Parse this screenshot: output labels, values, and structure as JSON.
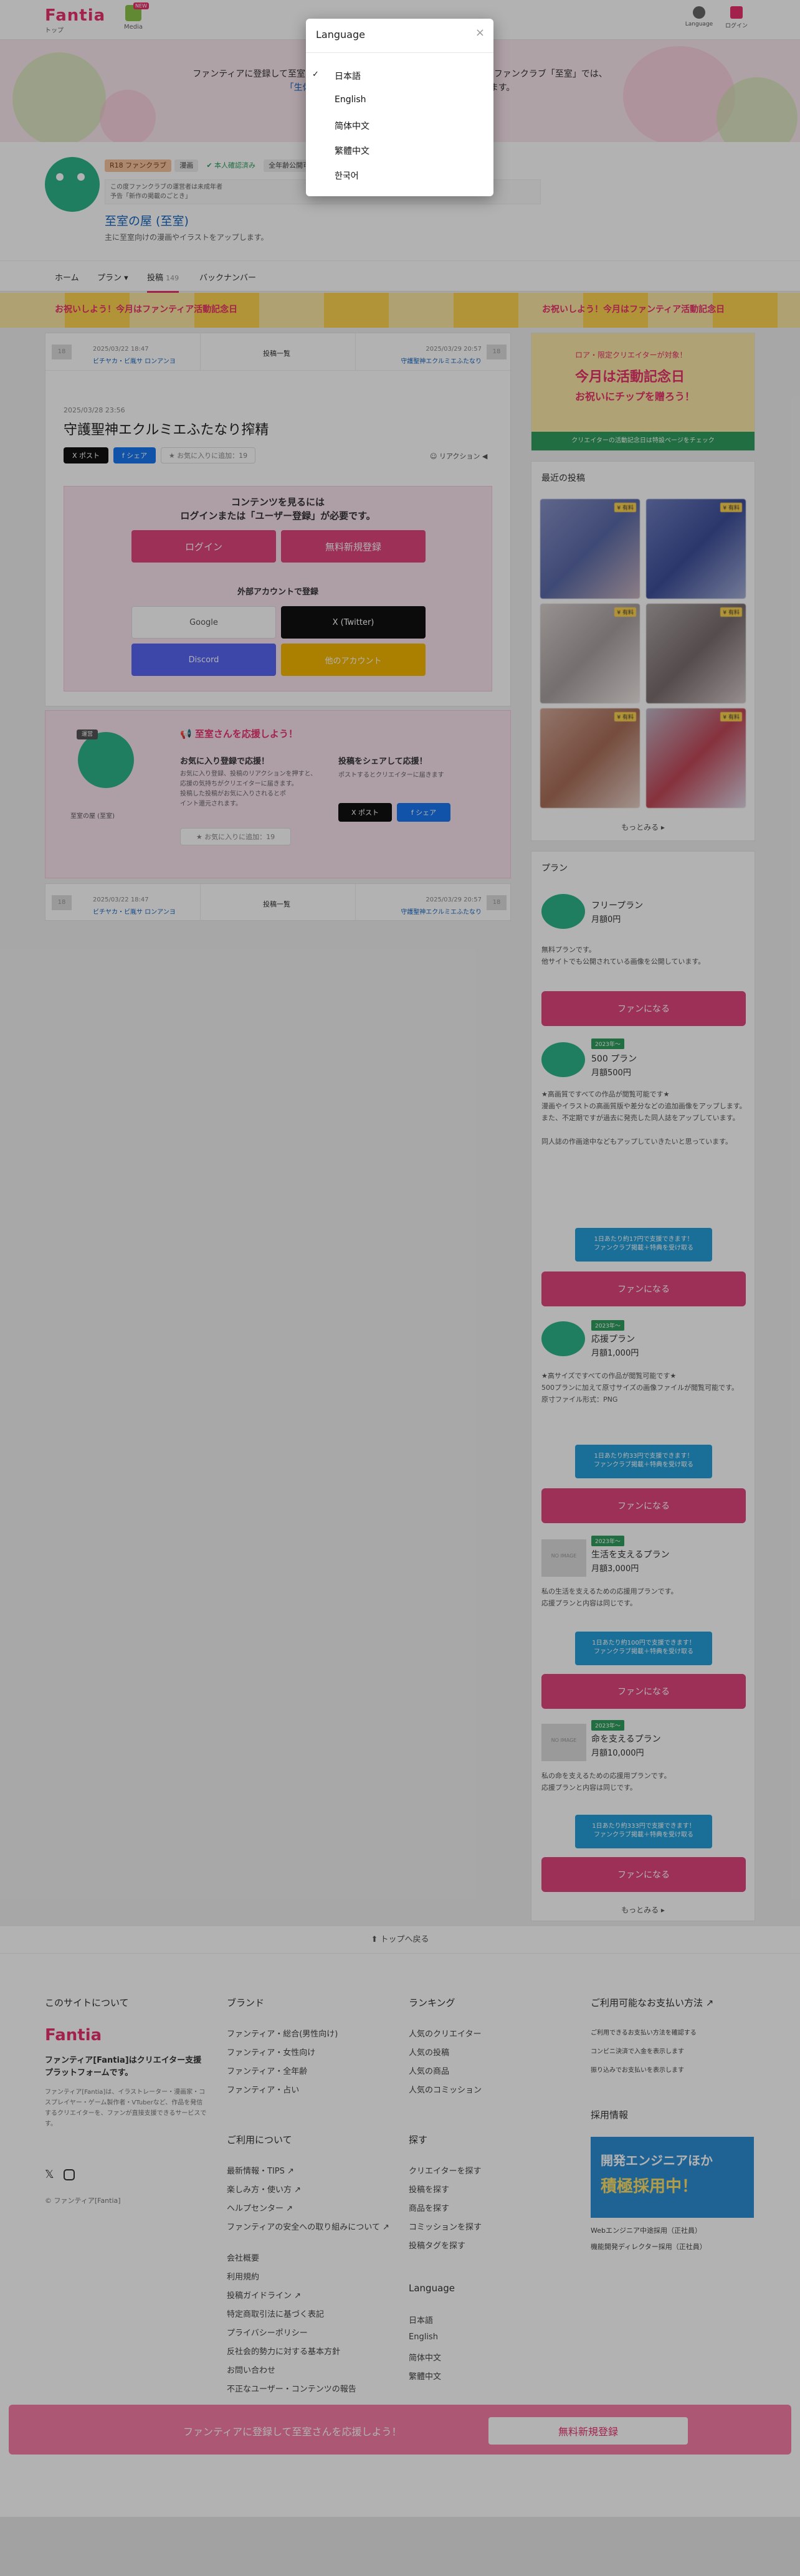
{
  "header": {
    "logo": "Fantia",
    "logo_sub": "トップ",
    "media_label": "Media",
    "new_badge": "NEW",
    "language_label": "Language",
    "login_label": "ログイン"
  },
  "banner": {
    "line1": "ファンティアに登録して至室さんを応援しよう！",
    "line1_right": "至室さんのファンクラブ「至室」では、",
    "line2": "「生体照料生成量",
    "line2_right": "いただけます。"
  },
  "profile": {
    "tag_adult": "R18 ファンクラブ",
    "tag_manga": "漫画",
    "tag_verified": "✔ 本人確認済み",
    "tag_extra": "全年齢公開可能・成人向け作品あり",
    "creator_name": "至室の屋 (至室)",
    "creator_desc": "主に至室向けの漫画やイラストをアップします。",
    "intro_l1": "この度ファンクラブの運営者は未成年者",
    "intro_l2": "予告「新作の掲載のごとき」"
  },
  "nav": {
    "home": "ホーム",
    "plans": "プラン",
    "posts": "投稿",
    "posts_count": "149",
    "backnumber": "バックナンバー"
  },
  "strip_text": "お祝いしよう！今月はファンティア活動記念日",
  "post": {
    "prev_date": "2025/03/22 18:47",
    "prev_title": "ビチヤカ・ビ胤サ ロンアンヨ",
    "list_label": "投稿一覧",
    "next_date": "2025/03/29 20:57",
    "next_title": "守護聖神エクルミエふたなり",
    "date": "2025/03/28 23:56",
    "title": "守護聖神エクルミエふたなり搾精",
    "share_x": "X ポスト",
    "share_fb": "f シェア",
    "fav_btn": "★ お気に入りに追加：19",
    "reaction": "☺ リアクション ◀"
  },
  "locked": {
    "heading1": "コンテンツを見るには",
    "heading2": "ログインまたは「ユーザー登録」が必要です。",
    "login": "ログイン",
    "register": "無料新規登録",
    "external_heading": "外部アカウントで登録",
    "google": "Google",
    "twitter": "X (Twitter)",
    "discord": "Discord",
    "other": "他のアカウント"
  },
  "support": {
    "badge": "運営",
    "title": "📢 至室さんを応援しよう！",
    "fav_title": "お気に入り登録で応援！",
    "fav_desc1": "お気に入り登録、投稿のリアクションを押すと、",
    "fav_desc2": "応援の気持ちがクリエイターに届きます。",
    "fav_desc3": "投稿した投稿がお気に入りされるとポ",
    "fav_desc4": "イント還元されます。",
    "share_title": "投稿をシェアして応援！",
    "share_desc": "ポストするとクリエイターに届きます",
    "fav_btn": "★ お気に入りに追加：19",
    "share_x": "X ポスト",
    "share_fb": "f シェア",
    "avatar_name": "至室の屋 (至室)"
  },
  "sidebar": {
    "promo_line1": "ロア・限定クリエイターが対象！",
    "promo_line2": "今月は活動記念日",
    "promo_line3": "お祝いにチップを贈ろう！",
    "promo_footer": "クリエイターの活動記念日は特設ページをチェック",
    "recent_title": "最近の投稿",
    "thumb_badge": "¥ 有料",
    "more": "もっとみる ▸",
    "plans_title": "プラン",
    "plans": [
      {
        "tag": "",
        "name": "フリープラン",
        "price": "月額0円",
        "desc": "無料プランです。\n他サイトでも公開されている画像を公開しています。",
        "tip": "",
        "button": "ファンになる"
      },
      {
        "tag": "2023年〜",
        "name": "500 プラン",
        "price": "月額500円",
        "desc": "★高画質ですべての作品が閲覧可能です★\n漫画やイラストの高画質版や差分などの追加画像をアップします。\nまた、不定期ですが過去に発売した同人誌をアップしています。\n\n同人誌の作画途中などもアップしていきたいと思っています。",
        "tip": "1日あたり約17円で支援できます！\nファンクラブ掲載＋特典を受け取る",
        "button": "ファンになる"
      },
      {
        "tag": "2023年〜",
        "name": "応援プラン",
        "price": "月額1,000円",
        "desc": "★高サイズですべての作品が閲覧可能です★\n500プランに加えて原寸サイズの画像ファイルが閲覧可能です。\n原寸ファイル形式：PNG",
        "tip": "1日あたり約33円で支援できます！\nファンクラブ掲載＋特典を受け取る",
        "button": "ファンになる"
      },
      {
        "tag": "2023年〜",
        "name": "生活を支えるプラン",
        "price": "月額3,000円",
        "desc": "私の生活を支えるための応援用プランです。\n応援プランと内容は同じです。",
        "tip": "1日あたり約100円で支援できます！\nファンクラブ掲載＋特典を受け取る",
        "button": "ファンになる"
      },
      {
        "tag": "2023年〜",
        "name": "命を支えるプラン",
        "price": "月額10,000円",
        "desc": "私の命を支えるための応援用プランです。\n応援プランと内容は同じです。",
        "tip": "1日あたり約333円で支援できます！\nファンクラブ掲載＋特典を受け取る",
        "button": "ファンになる"
      }
    ],
    "no_image": "NO IMAGE"
  },
  "back_to_top": "⬆ トップへ戻る",
  "footer": {
    "about_head": "このサイトについて",
    "about_logo": "Fantia",
    "about_title": "ファンティア[Fantia]はクリエイター支援プラットフォームです。",
    "about_desc": "ファンティア[Fantia]は、イラストレーター・漫画家・コスプレイヤー・ゲーム製作者・VTuberなど、作品を発信するクリエイターを、ファンが直接支援できるサービスです。",
    "copyright": "© ファンティア[Fantia]",
    "brand_head": "ブランド",
    "brand_links": [
      "ファンティア・総合(男性向け)",
      "ファンティア・女性向け",
      "ファンティア・全年齢",
      "ファンティア・占い"
    ],
    "ranking_head": "ランキング",
    "ranking_links": [
      "人気のクリエイター",
      "人気の投稿",
      "人気の商品",
      "人気のコミッション"
    ],
    "help_head": "ご利用可能なお支払い方法 ↗",
    "help_links": [
      "ご利用できるお支払い方法を確認する",
      "コンビニ決済で入金を表示します",
      "振り込みでお支払いを表示します"
    ],
    "use_head": "ご利用について",
    "use_links": [
      "最新情報・TIPS ↗",
      "楽しみ方・使い方 ↗",
      "ヘルプセンター ↗",
      "ファンティアの安全への取り組みについて ↗",
      "会社概要",
      "利用規約",
      "投稿ガイドライン ↗",
      "特定商取引法に基づく表記",
      "プライバシーポリシー",
      "反社会的勢力に対する基本方針",
      "お問い合わせ",
      "不正なユーザー・コンテンツの報告"
    ],
    "find_head": "探す",
    "find_links": [
      "クリエイターを探す",
      "投稿を探す",
      "商品を探す",
      "コミッションを探す",
      "投稿タグを探す"
    ],
    "jobs_head": "採用情報",
    "jobs_banner1": "開発エンジニアほか",
    "jobs_banner2": "積極採用中！",
    "jobs_links": [
      "Webエンジニア中途採用（正社員）",
      "機能開発ディレクター採用（正社員）"
    ],
    "lang_head": "Language",
    "lang_links": [
      "日本語",
      "English",
      "简体中文",
      "繁體中文"
    ]
  },
  "bottom_bar": {
    "text": "ファンティアに登録して至室さんを応援しよう！",
    "button": "無料新規登録"
  },
  "modal": {
    "title": "Language",
    "close": "×",
    "options": [
      "日本語",
      "English",
      "简体中文",
      "繁體中文",
      "한국어"
    ],
    "selected_index": 0,
    "checkmark": "✓"
  },
  "colors": {
    "brand": "#e8326d",
    "link": "#1565c0",
    "overlay": "rgba(0,0,0,0.3)"
  }
}
